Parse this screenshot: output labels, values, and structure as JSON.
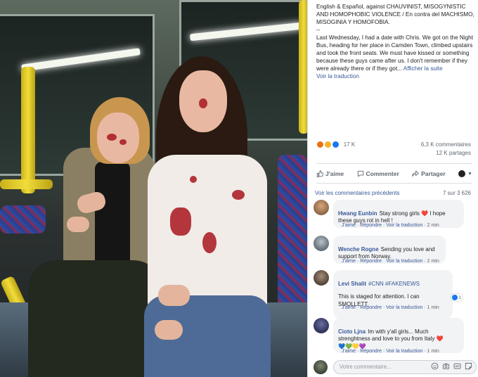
{
  "post": {
    "text_header": "English & Español, against CHAUVINIST, MISOGYNISTIC AND HOMOPHOBIC VIOLENCE / En contra del MACHISMO, MISOGINIA Y HOMOFOBIA.",
    "separator": "--",
    "text_body": "Last Wednesday, I had a date with Chris. We got on the Night Bus, heading for her place in Camden Town, climbed upstairs and took the front seats. We must have kissed or something because these guys came after us. I don't remember if they were already there or if they got...",
    "see_more": "Afficher la suite",
    "translate": "Voir la traduction"
  },
  "reactions": {
    "count": "17 K",
    "comments": "6,3 K commentaires",
    "shares": "12 K partages",
    "colors": {
      "angry": "#e9710f",
      "sad": "#f7b125",
      "like": "#1877f2"
    }
  },
  "actions": {
    "like": "J'aime",
    "comment": "Commenter",
    "share": "Partager"
  },
  "comments_header": {
    "previous": "Voir les commentaires précédents",
    "count": "7 sur 3 626"
  },
  "comments": [
    {
      "name": "Hwang Eunbin",
      "text": "Stay strong girls ❤️ I hope\nthese guys rot in hell !",
      "like": "J'aime",
      "reply": "Répondre",
      "translate": "Voir la traduction",
      "time": "2 min"
    },
    {
      "name": "Wenche Rogne",
      "text": "Sending you love and\nsupport from Norway.",
      "like": "J'aime",
      "reply": "Répondre",
      "translate": "Voir la traduction",
      "time": "2 min"
    },
    {
      "name": "Levi Shalit",
      "tags": "#CNN #FAKENEWS",
      "text": "This is staged for attention. I can\nSMOLLETT.",
      "like": "J'aime",
      "reply": "Répondre",
      "translate": "Voir la traduction",
      "time": "1 min",
      "reaction_count": "1"
    },
    {
      "name": "Cioto Ljna",
      "text": "Im with y'all girls... Much\nstrenghtness and love to you from Italy ❤️\n💙💚💛💜",
      "like": "J'aime",
      "reply": "Répondre",
      "translate": "Voir la traduction",
      "time": "1 min"
    }
  ],
  "composer": {
    "placeholder": "Votre commentaire..."
  },
  "icons": [
    "like-thumb-icon",
    "comment-bubble-icon",
    "share-arrow-icon",
    "emoji-icon",
    "camera-icon",
    "gif-icon",
    "sticker-icon"
  ]
}
